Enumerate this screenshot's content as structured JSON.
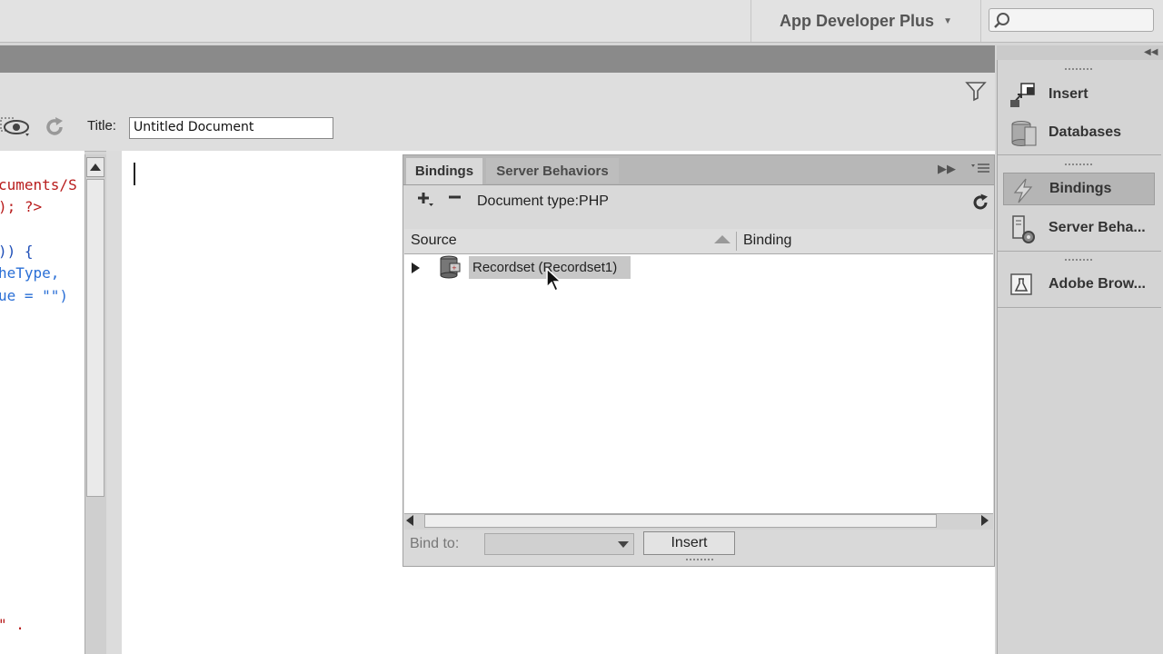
{
  "topbar": {
    "workspace_label": "App Developer Plus",
    "search_placeholder": ""
  },
  "document_toolbar": {
    "title_label": "Title:",
    "title_value": "Untitled Document"
  },
  "code_lines": [
    {
      "text": "cuments/S",
      "color": "#b81c1c"
    },
    {
      "text": "); ?>",
      "color": "#b81c1c"
    },
    {
      "text": ")) {",
      "color": "#1f4fb8"
    },
    {
      "text": "heType,",
      "color": "#2a6fd6"
    },
    {
      "text": "ue = \"\")",
      "color": "#2a6fd6"
    },
    {
      "text": "\" .",
      "color": "#b81c1c"
    }
  ],
  "bindings_panel": {
    "tabs": [
      "Bindings",
      "Server Behaviors"
    ],
    "doc_type": "Document type:PHP",
    "columns": {
      "source": "Source",
      "binding": "Binding"
    },
    "rows": [
      {
        "label": "Recordset (Recordset1)"
      }
    ],
    "bind_to_label": "Bind to:",
    "bind_to_value": "",
    "insert_label": "Insert"
  },
  "right_dock": {
    "items": [
      {
        "label": "Insert",
        "icon": "insert-icon"
      },
      {
        "label": "Databases",
        "icon": "databases-icon"
      },
      {
        "label": "Bindings",
        "icon": "bindings-icon",
        "active": true
      },
      {
        "label": "Server Beha...",
        "icon": "server-behaviors-icon"
      },
      {
        "label": "Adobe Brow...",
        "icon": "adobe-browserlab-icon"
      }
    ]
  }
}
